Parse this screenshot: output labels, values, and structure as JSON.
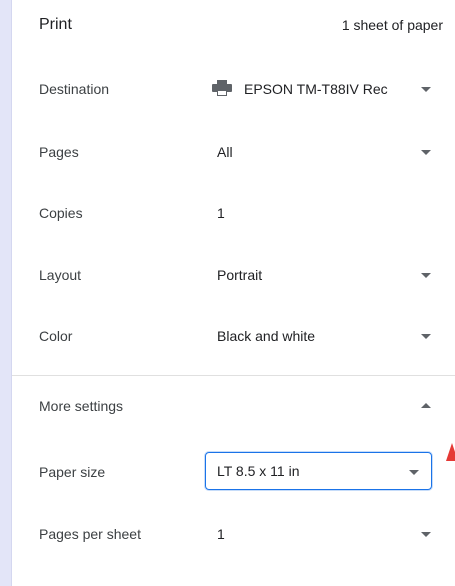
{
  "header": {
    "title": "Print",
    "sheet_count": "1 sheet of paper"
  },
  "settings": {
    "destination": {
      "label": "Destination",
      "value": "EPSON TM-T88IV Rec",
      "icon": "printer-icon"
    },
    "pages": {
      "label": "Pages",
      "value": "All"
    },
    "copies": {
      "label": "Copies",
      "value": "1"
    },
    "layout": {
      "label": "Layout",
      "value": "Portrait"
    },
    "color": {
      "label": "Color",
      "value": "Black and white"
    }
  },
  "more_settings": {
    "label": "More settings",
    "paper_size": {
      "label": "Paper size",
      "value": "LT 8.5 x 11 in"
    },
    "pages_per_sheet": {
      "label": "Pages per sheet",
      "value": "1"
    }
  },
  "colors": {
    "accent": "#1a73e8",
    "sidebar": "#e3e5f8",
    "pointer": "#e53935"
  }
}
